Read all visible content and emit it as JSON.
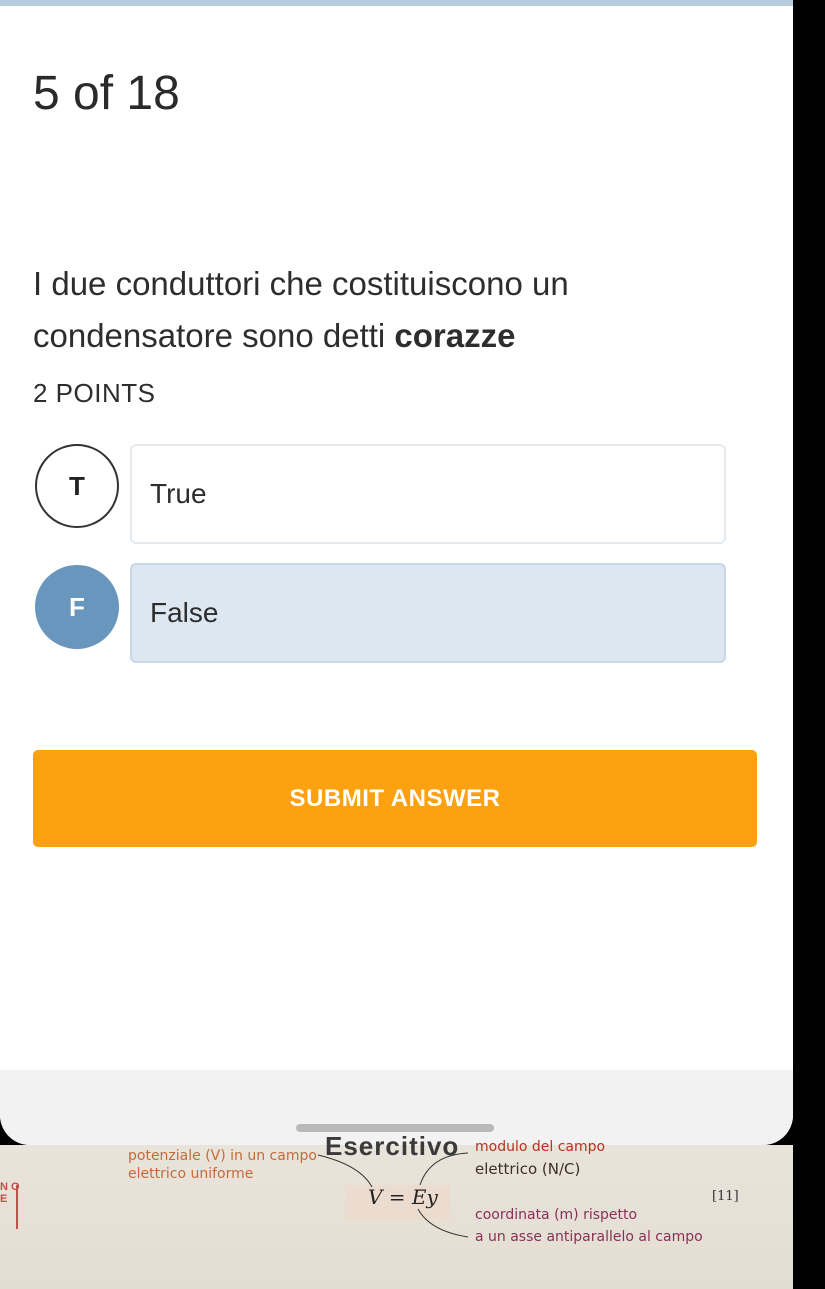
{
  "topbar": {
    "color": "#b7cce0"
  },
  "counter": "5 of 18",
  "question": {
    "text": "I due conduttori che costituiscono un condensatore sono detti ",
    "bold": "corazze"
  },
  "points": "2 POINTS",
  "options": [
    {
      "letter": "T",
      "label": "True",
      "selected": false
    },
    {
      "letter": "F",
      "label": "False",
      "selected": true
    }
  ],
  "submit_label": "SUBMIT ANSWER",
  "colors": {
    "accent": "#fca10f",
    "selected": "#6896bd",
    "selected_bg": "#dce7f2"
  },
  "photo": {
    "heading": "Esercitivo",
    "left_line1": "potenziale (V) in un campo",
    "left_line2": "elettrico uniforme",
    "right_line1": "modulo del campo",
    "right_line2": "elettrico (N/C)",
    "formula": "V = Ey",
    "eq_number": "[11]",
    "right_line3": "coordinata (m) rispetto",
    "right_line4": "a un asse antiparallelo al campo",
    "side_letters": "N O E"
  }
}
